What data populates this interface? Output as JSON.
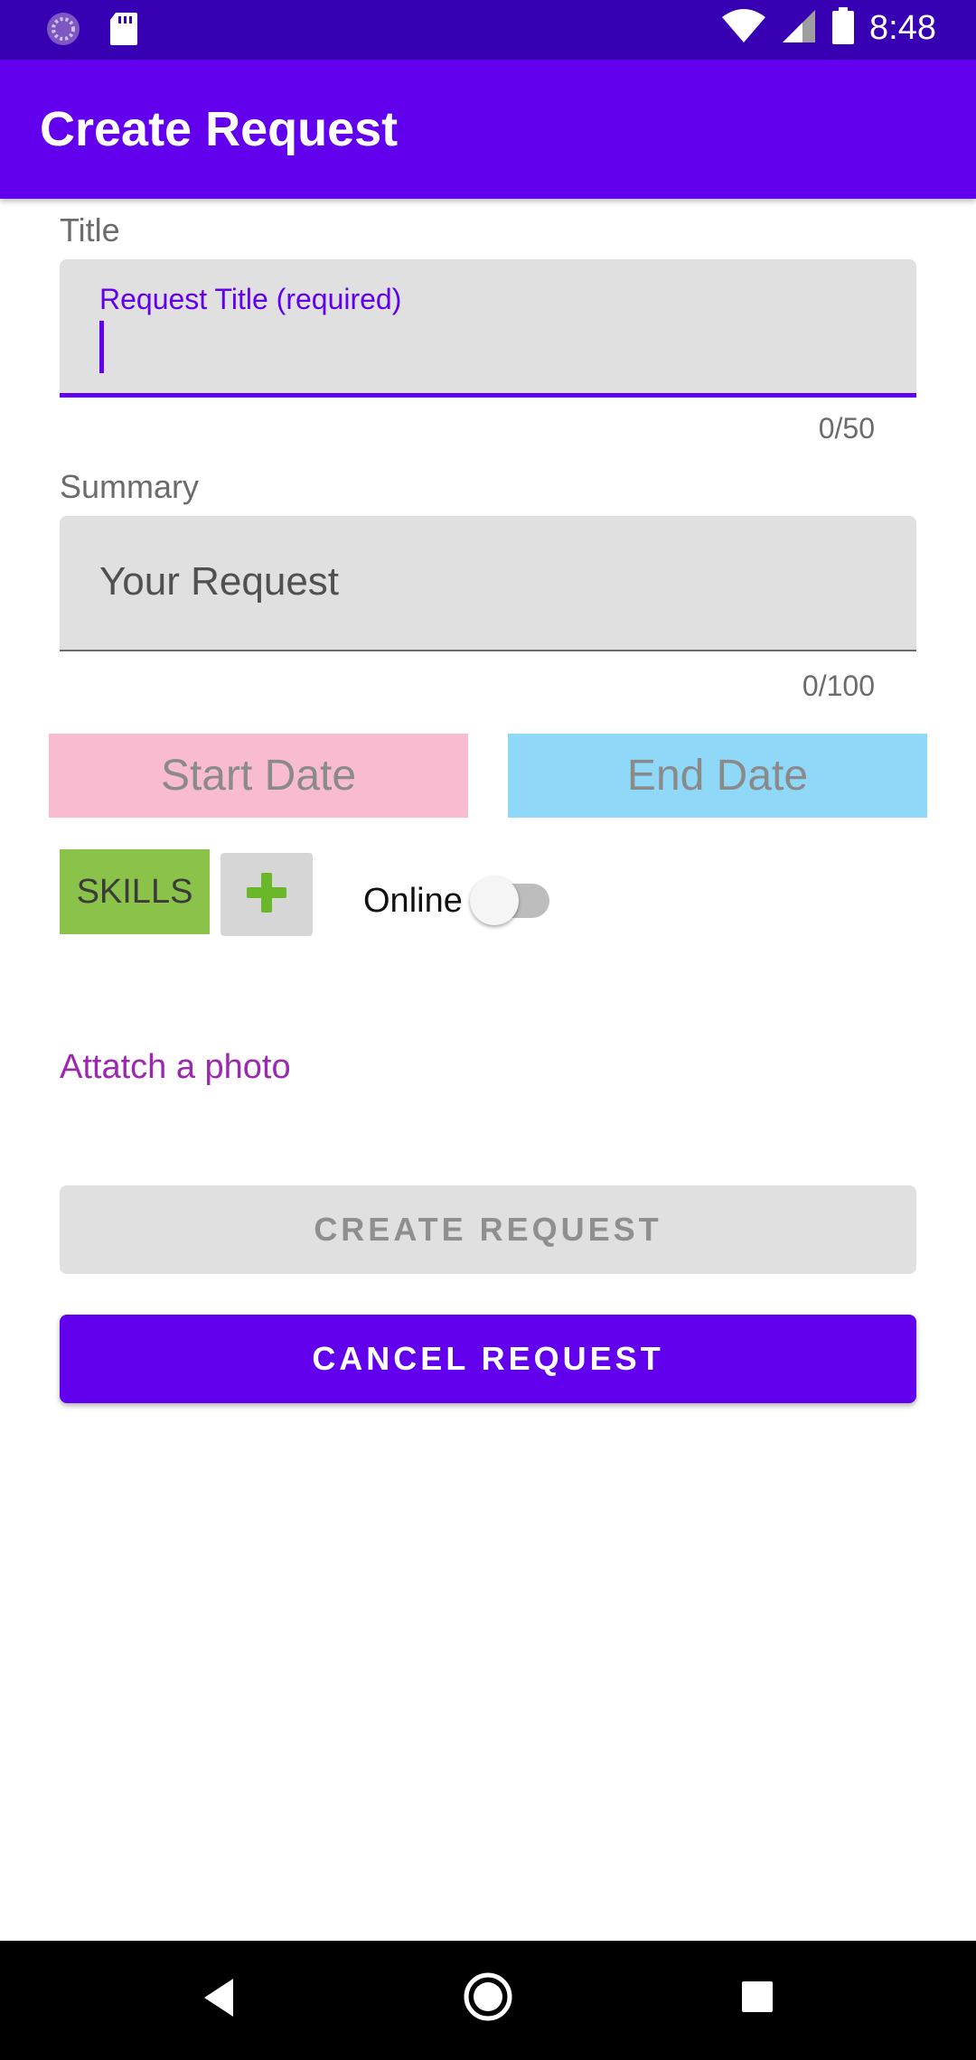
{
  "status_bar": {
    "time": "8:48",
    "left_icons": [
      "sync-icon",
      "sd-card-icon"
    ],
    "right_icons": [
      "wifi-icon",
      "signal-icon",
      "battery-icon"
    ]
  },
  "app_bar": {
    "title": "Create Request"
  },
  "title_section": {
    "label": "Title",
    "floating_label": "Request Title (required)",
    "value": "",
    "counter": "0/50"
  },
  "summary_section": {
    "label": "Summary",
    "placeholder": "Your Request",
    "counter": "0/100"
  },
  "dates": {
    "start_label": "Start Date",
    "end_label": "End Date",
    "start_color": "#f8bbd0",
    "end_color": "#90d8f8"
  },
  "skills": {
    "chip_label": "SKILLS",
    "add_icon": "plus-icon"
  },
  "online_toggle": {
    "label": "Online",
    "checked": false
  },
  "attach_photo": {
    "label": "Attatch a photo"
  },
  "actions": {
    "create_label": "CREATE REQUEST",
    "cancel_label": "CANCEL REQUEST"
  },
  "colors": {
    "primary": "#6200ee",
    "primary_dark": "#3700b3",
    "accent_green": "#8bc34a",
    "link_purple": "#9c27b0"
  },
  "nav_bar": {
    "icons": [
      "back-icon",
      "home-icon",
      "recents-icon"
    ]
  }
}
